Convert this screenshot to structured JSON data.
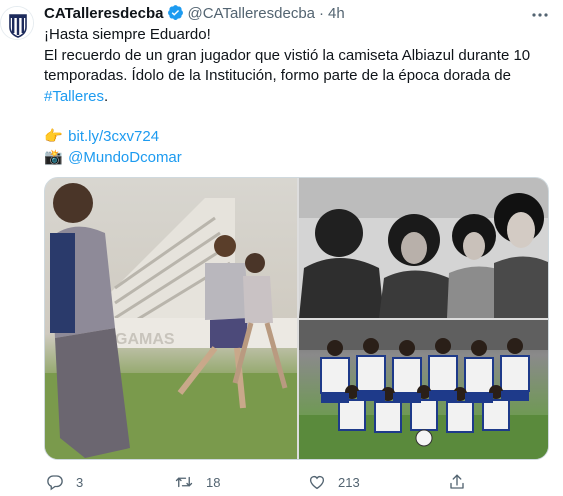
{
  "tweet": {
    "display_name": "CATalleresdecba",
    "handle": "@CATalleresdecba",
    "separator": "·",
    "time": "4h",
    "lines": {
      "l1": "¡Hasta siempre Eduardo!",
      "l2": "El recuerdo de un gran jugador que vistió la camiseta Albiazul durante 10",
      "l3": "temporadas. Ídolo de la Institución, formo parte de la época dorada de",
      "hashtag": "#Talleres",
      "hashtag_suffix": ".",
      "link": "bit.ly/3cxv724",
      "mention": "@MundoDcomar"
    },
    "emoji": {
      "pointing": "👉",
      "camera": "📸"
    },
    "counts": {
      "replies": "3",
      "retweets": "18",
      "likes": "213"
    },
    "colors": {
      "accent": "#1d9bf0",
      "muted": "#536471",
      "text": "#0f1419"
    },
    "icons": {
      "avatar": "club-crest",
      "verified": "verified-badge-icon",
      "more": "more-icon",
      "reply": "reply-icon",
      "retweet": "retweet-icon",
      "like": "like-icon",
      "share": "share-icon"
    }
  }
}
